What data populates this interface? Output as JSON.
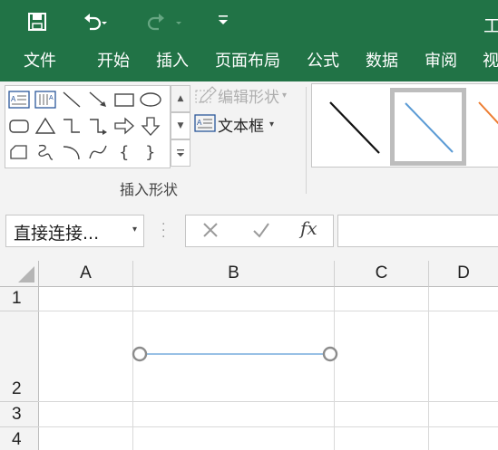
{
  "tabs": [
    "文件",
    "开始",
    "插入",
    "页面布局",
    "公式",
    "数据",
    "审阅",
    "视"
  ],
  "title_fragment": "工",
  "ribbon": {
    "edit_shape_label": "编辑形状",
    "textbox_label": "文本框",
    "insert_shapes_group": "插入形状",
    "shape_icons": [
      "textbox-icon",
      "vertical-textbox-icon",
      "line-icon",
      "arrow-line-icon",
      "rectangle-icon",
      "oval-icon",
      "rounded-rectangle-icon",
      "triangle-icon",
      "elbow-connector-icon",
      "elbow-arrow-connector-icon",
      "right-arrow-icon",
      "down-arrow-icon",
      "freeform-icon",
      "scribble-icon",
      "arc-icon",
      "curve-icon",
      "left-brace-icon",
      "right-brace-icon"
    ]
  },
  "formula_bar": {
    "name_box_value": "直接连接...",
    "fx_label": "fx",
    "formula_value": ""
  },
  "grid": {
    "columns": [
      "A",
      "B",
      "C",
      "D"
    ],
    "rows": [
      "1",
      "2",
      "3",
      "4"
    ]
  },
  "colors": {
    "brand_green": "#217346",
    "shape_line": "#5b9bd5",
    "handle": "#8c8c8c"
  }
}
